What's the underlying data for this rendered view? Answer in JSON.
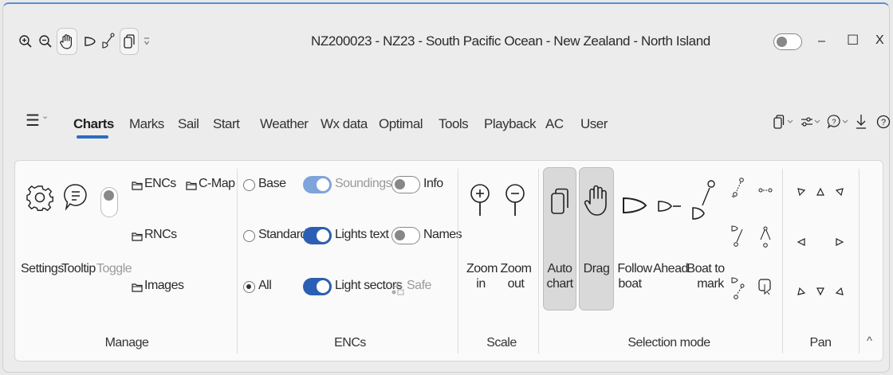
{
  "window": {
    "title": "NZ200023 - NZ23 - South Pacific Ocean - New Zealand - North Island",
    "minimize_glyph": "–",
    "maximize_glyph": "☐",
    "close_glyph": "X"
  },
  "quick_access": {
    "icons": [
      "zoom-in-icon",
      "zoom-out-icon",
      "hand-icon",
      "follow-boat-icon",
      "boat-to-mark-icon",
      "auto-chart-icon",
      "customize-icon"
    ]
  },
  "menu": {
    "glyph": "☰",
    "chevron": "⌄"
  },
  "tabs": [
    "Charts",
    "Marks",
    "Sail",
    "Start",
    "Weather",
    "Wx data",
    "Optimal",
    "Tools",
    "Playback",
    "AC",
    "User"
  ],
  "active_tab": "Charts",
  "right_icons": [
    "window-icon",
    "settings-sliders-icon",
    "help-bubble-icon",
    "download-icon",
    "help-icon"
  ],
  "manage": {
    "label": "Manage",
    "settings": "Settings",
    "tooltip": "Tooltip",
    "toggle": "Toggle",
    "encs": "ENCs",
    "cmap": "C-Map",
    "rncs": "RNCs",
    "images": "Images"
  },
  "encs": {
    "label": "ENCs",
    "base": "Base",
    "standard": "Standard",
    "all": "All",
    "soundings": "Soundings",
    "lights_text": "Lights text",
    "light_sectors": "Light sectors",
    "info": "Info",
    "names": "Names",
    "safe": "Safe"
  },
  "scale": {
    "label": "Scale",
    "zoom_in_1": "Zoom",
    "zoom_in_2": "in",
    "zoom_out_1": "Zoom",
    "zoom_out_2": "out"
  },
  "selection": {
    "label": "Selection mode",
    "auto_1": "Auto",
    "auto_2": "chart",
    "drag": "Drag",
    "follow_1": "Follow",
    "follow_2": "boat",
    "ahead": "Ahead",
    "btm_1": "Boat to",
    "btm_2": "mark"
  },
  "pan": {
    "label": "Pan"
  },
  "collapse_glyph": "^"
}
